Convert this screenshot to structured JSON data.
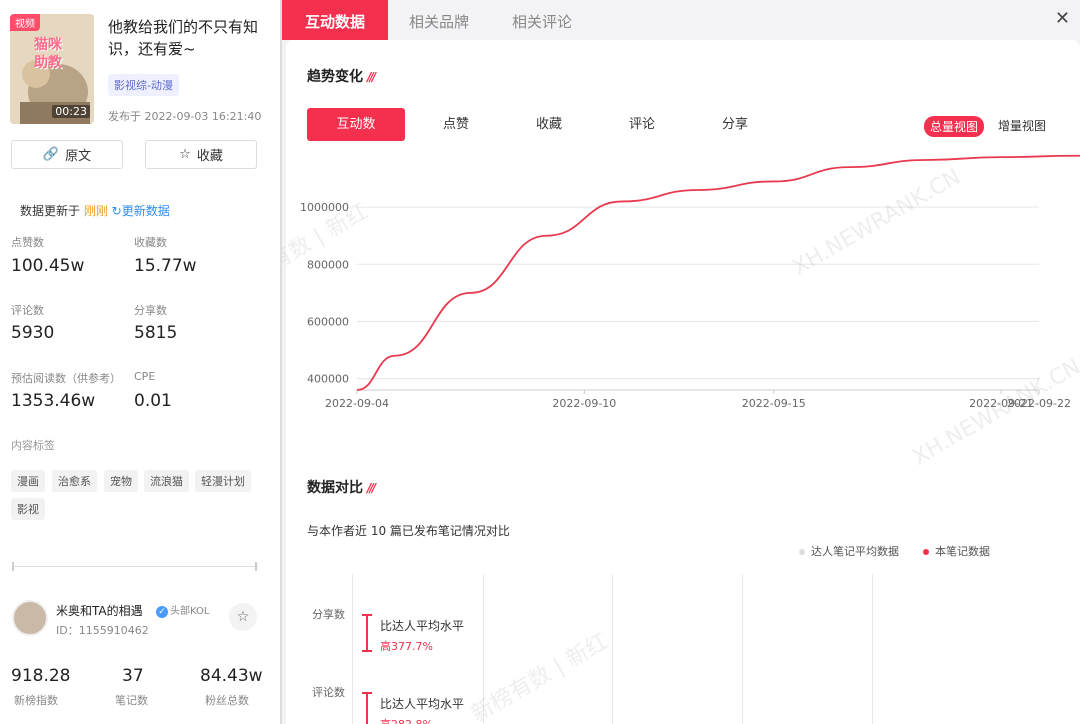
{
  "video": {
    "tag": "视频",
    "art_text": "猫咪\n助教",
    "duration": "00:23",
    "title": "他教给我们的不只有知识，还有爱~",
    "category": "影视综-动漫",
    "publish_time": "发布于  2022-09-03 16:21:40"
  },
  "buttons": {
    "source": "原文",
    "favorite": "收藏"
  },
  "update": {
    "prefix": "数据更新于 ",
    "when": "刚刚",
    "refresh": "更新数据"
  },
  "stats": [
    {
      "label": "点赞数",
      "value": "100.45w"
    },
    {
      "label": "收藏数",
      "value": "15.77w"
    },
    {
      "label": "评论数",
      "value": "5930"
    },
    {
      "label": "分享数",
      "value": "5815"
    },
    {
      "label": "预估阅读数（供参考）",
      "value": "1353.46w"
    },
    {
      "label": "CPE",
      "value": "0.01"
    }
  ],
  "tags_label": "内容标签",
  "tags": [
    "漫画",
    "治愈系",
    "宠物",
    "流浪猫",
    "轻漫计划",
    "影视"
  ],
  "author": {
    "name": "米奥和TA的相遇",
    "badge": "头部KOL",
    "id": "ID：1155910462",
    "stats": [
      {
        "value": "918.28",
        "label": "新榜指数"
      },
      {
        "value": "37",
        "label": "笔记数"
      },
      {
        "value": "84.43w",
        "label": "粉丝总数"
      }
    ]
  },
  "tabs": [
    "互动数据",
    "相关品牌",
    "相关评论"
  ],
  "trend": {
    "title": "趋势变化",
    "metric_tabs": [
      "互动数",
      "点赞",
      "收藏",
      "评论",
      "分享"
    ],
    "view_tabs": [
      "总量视图",
      "增量视图"
    ]
  },
  "chart_data": {
    "type": "line",
    "x": [
      "2022-09-04",
      "2022-09-05",
      "2022-09-07",
      "2022-09-09",
      "2022-09-11",
      "2022-09-13",
      "2022-09-15",
      "2022-09-17",
      "2022-09-19",
      "2022-09-21",
      "2022-09-23",
      "2022-09-24"
    ],
    "series": [
      {
        "values": [
          360000,
          480000,
          700000,
          900000,
          1020000,
          1060000,
          1090000,
          1140000,
          1165000,
          1175000,
          1180000,
          1180000
        ]
      }
    ],
    "xticks": [
      "2022-09-04",
      "2022-09-10",
      "2022-09-15",
      "2022-09-21",
      "2022-09-22"
    ],
    "yticks": [
      "400000",
      "600000",
      "800000",
      "1000000"
    ],
    "ylim": [
      360000,
      1200000
    ],
    "grid": true,
    "color": "#e8394f"
  },
  "compare": {
    "title": "数据对比",
    "note": "与本作者近 10 篇已发布笔记情况对比",
    "legend": [
      "达人笔记平均数据",
      "本笔记数据"
    ],
    "rows": [
      {
        "label": "分享数",
        "text": "比达人平均水平",
        "value": "高377.7%"
      },
      {
        "label": "评论数",
        "text": "比达人平均水平",
        "value": "高282.8%"
      }
    ]
  },
  "watermark": "新榜有数 | 新红",
  "watermark_url": "XH.NEWRANK.CN"
}
